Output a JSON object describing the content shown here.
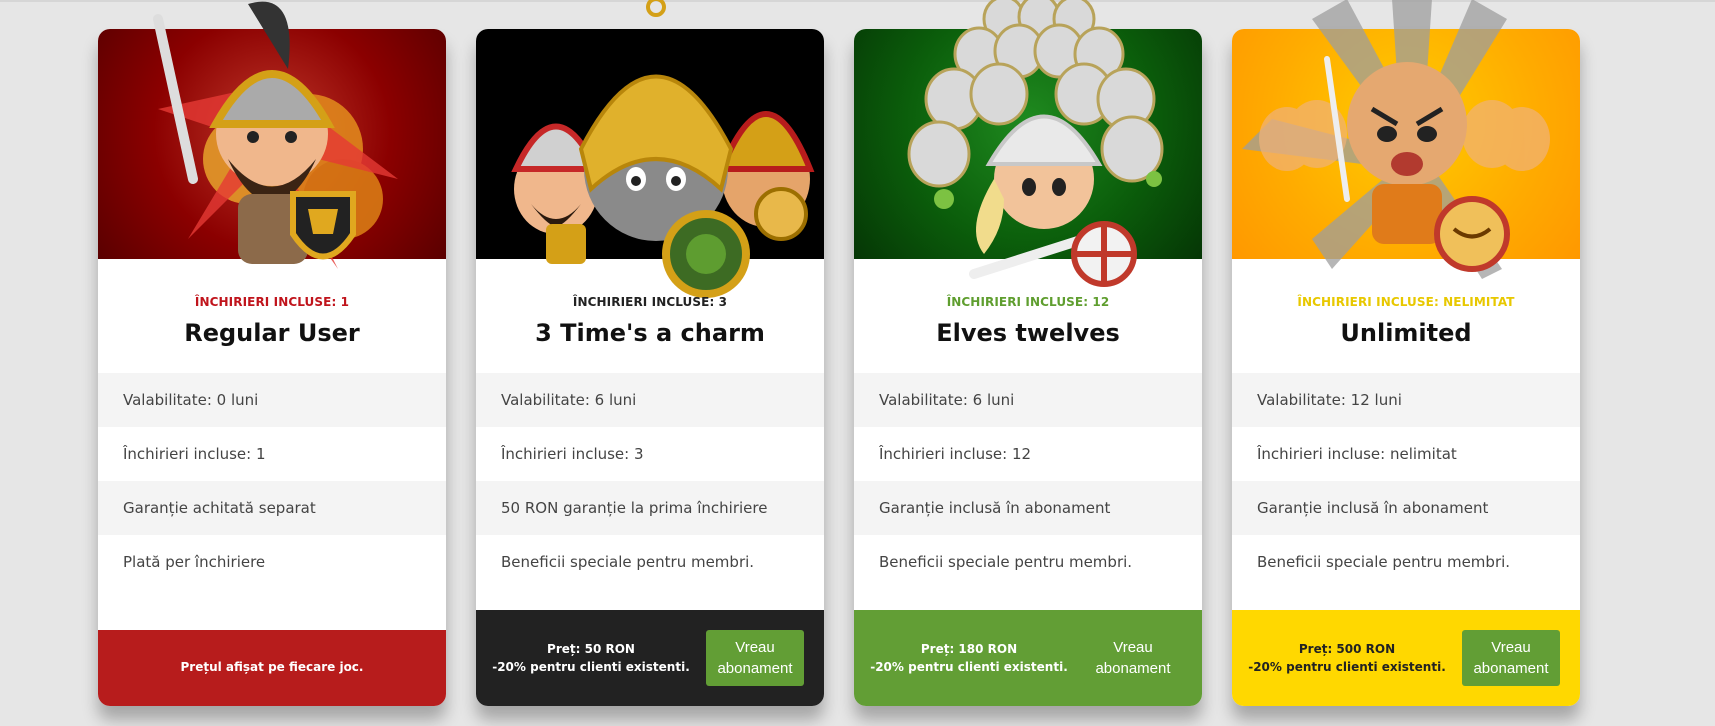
{
  "plans": [
    {
      "id": "regular",
      "subtitle": "ÎNCHIRIERI INCLUSE: 1",
      "title": "Regular User",
      "features": [
        "Valabilitate: 0 luni",
        "Închirieri incluse: 1",
        "Garanție achitată separat",
        "Plată per închiriere"
      ],
      "footer_note": "Prețul afișat pe fiecare joc.",
      "colors": {
        "hero_bg": "#8b0000",
        "accent": "#c0141c",
        "footer_bg": "#b71c1c",
        "footer_text": "#ffffff"
      }
    },
    {
      "id": "three",
      "subtitle": "ÎNCHIRIERI INCLUSE: 3",
      "title": "3 Time's a charm",
      "features": [
        "Valabilitate: 6 luni",
        "Închirieri incluse: 3",
        "50 RON garanție la prima închiriere",
        "Beneficii speciale pentru membri."
      ],
      "price_line1": "Preț: 50 RON",
      "price_line2": "-20% pentru clienti existenti.",
      "button_label": "Vreau abonament",
      "colors": {
        "hero_bg": "#000000",
        "accent": "#222222",
        "footer_bg": "#222222",
        "footer_text": "#ffffff"
      }
    },
    {
      "id": "elves",
      "subtitle": "ÎNCHIRIERI INCLUSE: 12",
      "title": "Elves twelves",
      "features": [
        "Valabilitate: 6 luni",
        "Închirieri incluse: 12",
        "Garanție inclusă în abonament",
        "Beneficii speciale pentru membri."
      ],
      "price_line1": "Preț: 180 RON",
      "price_line2": "-20% pentru clienti existenti.",
      "button_label": "Vreau abonament",
      "colors": {
        "hero_bg": "#0b5e0b",
        "accent": "#5f9e2f",
        "footer_bg": "#629e35",
        "footer_text": "#ffffff"
      }
    },
    {
      "id": "unlimited",
      "subtitle": "ÎNCHIRIERI INCLUSE: NELIMITAT",
      "title": "Unlimited",
      "features": [
        "Valabilitate: 12 luni",
        "Închirieri incluse: nelimitat",
        "Garanție inclusă în abonament",
        "Beneficii speciale pentru membri."
      ],
      "price_line1": "Preț: 500 RON",
      "price_line2": "-20% pentru clienti existenti.",
      "button_label": "Vreau abonament",
      "colors": {
        "hero_bg": "#ffab00",
        "accent": "#e8c800",
        "footer_bg": "#ffd800",
        "footer_text": "#222222"
      }
    }
  ]
}
